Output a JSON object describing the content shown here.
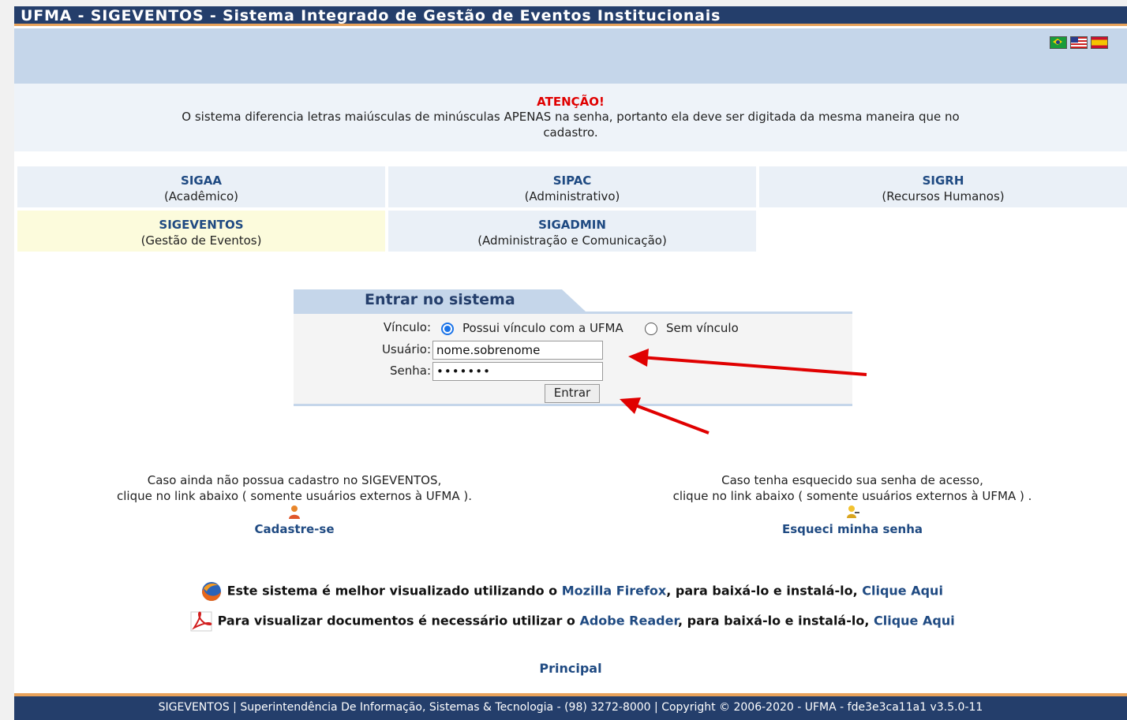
{
  "header": {
    "title": "UFMA - SIGEVENTOS - Sistema Integrado de Gestão de Eventos Institucionais",
    "flags": [
      "brazil-flag-icon",
      "usa-flag-icon",
      "spain-flag-icon"
    ]
  },
  "attention": {
    "title": "ATENÇÃO!",
    "text": "O sistema diferencia letras maiúsculas de minúsculas APENAS na senha, portanto ela deve ser digitada da mesma maneira que no cadastro."
  },
  "systems": [
    {
      "name": "SIGAA",
      "sub": "(Acadêmico)"
    },
    {
      "name": "SIPAC",
      "sub": "(Administrativo)"
    },
    {
      "name": "SIGRH",
      "sub": "(Recursos Humanos)"
    },
    {
      "name": "SIGEVENTOS",
      "sub": "(Gestão de Eventos)"
    },
    {
      "name": "SIGADMIN",
      "sub": "(Administração e Comunicação)"
    }
  ],
  "login": {
    "title": "Entrar no sistema",
    "vinculo_label": "Vínculo:",
    "option_ufma": "Possui vínculo com a UFMA",
    "option_sem": "Sem vínculo",
    "usuario_label": "Usuário:",
    "usuario_value": "nome.sobrenome",
    "senha_label": "Senha:",
    "senha_value": "•••••••",
    "submit": "Entrar"
  },
  "help": {
    "register_line1": "Caso ainda não possua cadastro no SIGEVENTOS,",
    "register_line2": "clique no link abaixo ( somente usuários externos à UFMA ).",
    "register_link": "Cadastre-se",
    "forgot_line1": "Caso tenha esquecido sua senha de acesso,",
    "forgot_line2": "clique no link abaixo ( somente usuários externos à UFMA ) .",
    "forgot_link": "Esqueci minha senha"
  },
  "notices": {
    "firefox_text": "Este sistema é melhor visualizado utilizando o ",
    "firefox_link": "Mozilla Firefox",
    "firefox_mid": ", para baixá-lo e instalá-lo, ",
    "firefox_click": "Clique Aqui",
    "reader_text": "Para visualizar documentos é necessário utilizar o ",
    "reader_link": "Adobe Reader",
    "reader_mid": ", para baixá-lo e instalá-lo, ",
    "reader_click": "Clique Aqui"
  },
  "principal": "Principal",
  "footer": "SIGEVENTOS | Superintendência De Informação, Sistemas & Tecnologia - (98) 3272-8000 | Copyright © 2006-2020 - UFMA - fde3e3ca11a1 v3.5.0-11",
  "colors": {
    "header": "#243e6b",
    "accent": "#e8a25a",
    "link": "#1f4a82",
    "attention": "#e00000",
    "arrow": "#e00000"
  }
}
